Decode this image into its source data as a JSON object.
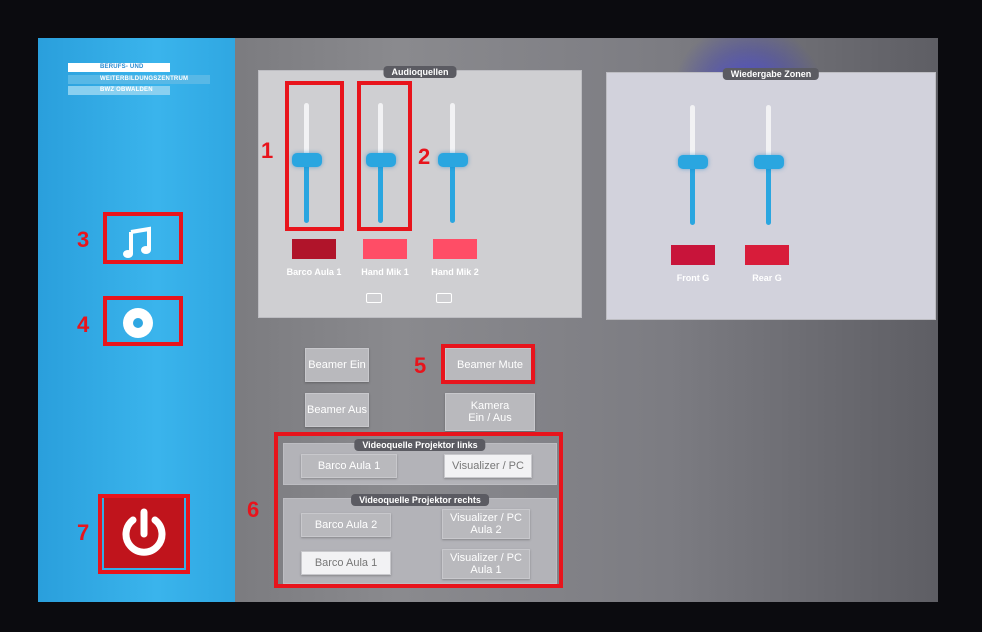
{
  "logo": {
    "line1": "BERUFS- UND",
    "line2": "WEITERBILDUNGSZENTRUM",
    "line3": "BWZ OBWALDEN"
  },
  "sidebar": {
    "music_icon": "music-note-icon",
    "disc_icon": "disc-icon",
    "power_icon": "power-icon"
  },
  "audio": {
    "title": "Audioquellen",
    "channels": [
      {
        "label": "Barco Aula 1",
        "color": "#b0142a"
      },
      {
        "label": "Hand Mik 1",
        "color": "#ff4d66"
      },
      {
        "label": "Hand Mik 2",
        "color": "#ff4d66"
      }
    ]
  },
  "zones": {
    "title": "Wiedergabe Zonen",
    "channels": [
      {
        "label": "Front G",
        "color": "#c8143a"
      },
      {
        "label": "Rear G",
        "color": "#d81c3a"
      }
    ]
  },
  "buttons": {
    "beamer_on": "Beamer Ein",
    "beamer_mute": "Beamer Mute",
    "beamer_off": "Beamer Aus",
    "camera": "Kamera\nEin / Aus"
  },
  "video_left": {
    "title": "Videoquelle Projektor links",
    "opt1": "Barco Aula 1",
    "opt2": "Visualizer / PC"
  },
  "video_right": {
    "title": "Videoquelle Projektor rechts",
    "opt1": "Barco Aula 2",
    "opt2": "Visualizer / PC\nAula 2",
    "opt3": "Barco Aula 1",
    "opt4": "Visualizer / PC\nAula 1"
  },
  "callouts": {
    "c1": "1",
    "c2": "2",
    "c3": "3",
    "c4": "4",
    "c5": "5",
    "c6": "6",
    "c7": "7"
  },
  "colors": {
    "sidebar": "#2fa7e2",
    "accent": "#2aa6e0",
    "annotation": "#e8141c",
    "power": "#c0141c"
  }
}
